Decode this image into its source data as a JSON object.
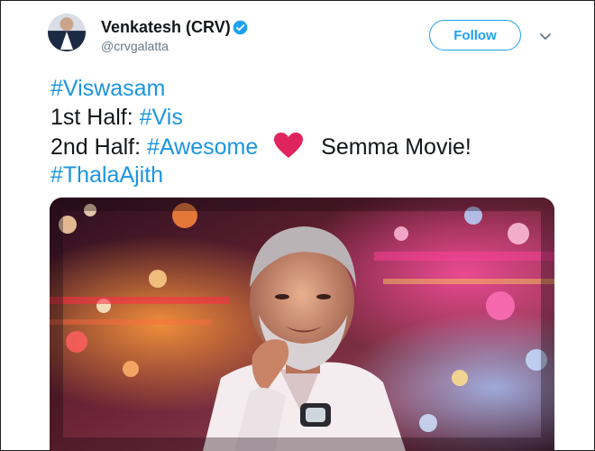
{
  "author": {
    "display_name": "Venkatesh (CRV)",
    "handle": "@crvgalatta",
    "verified_icon": "verified-badge-icon",
    "avatar_icon": "avatar"
  },
  "actions": {
    "follow_label": "Follow",
    "menu_icon": "chevron-down-icon"
  },
  "tweet": {
    "line1": {
      "hashtag": "#Viswasam"
    },
    "line2": {
      "prefix": "1st Half: ",
      "hashtag": "#Vis"
    },
    "line3": {
      "prefix": "2nd Half: ",
      "hashtag": "#Awesome",
      "emoji": "heart-icon",
      "suffix": "Semma Movie!"
    },
    "line4": {
      "hashtag": "#ThalaAjith"
    }
  },
  "colors": {
    "accent": "#1da1f2",
    "hashtag": "#1b95e0",
    "text": "#14171a",
    "muted": "#657786",
    "heart": "#e0245e"
  },
  "media": {
    "type": "photo"
  }
}
